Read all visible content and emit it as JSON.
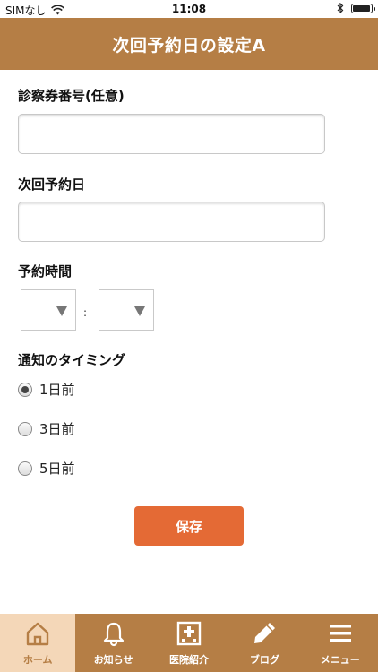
{
  "status_bar": {
    "carrier": "SIMなし",
    "time": "11:08",
    "battery_level": 0.95
  },
  "header": {
    "title": "次回予約日の設定A"
  },
  "form": {
    "card_number_label": "診察券番号(任意)",
    "card_number_value": "",
    "next_date_label": "次回予約日",
    "next_date_value": "",
    "time_label": "予約時間",
    "hour_value": "",
    "minute_value": "",
    "time_separator": ":",
    "timing_label": "通知のタイミング",
    "timing_options": [
      {
        "label": "1日前",
        "checked": true
      },
      {
        "label": "3日前",
        "checked": false
      },
      {
        "label": "5日前",
        "checked": false
      }
    ],
    "save_label": "保存"
  },
  "tabbar": {
    "items": [
      {
        "label": "ホーム",
        "icon": "home-icon",
        "active": true
      },
      {
        "label": "お知らせ",
        "icon": "bell-icon",
        "active": false
      },
      {
        "label": "医院紹介",
        "icon": "hospital-icon",
        "active": false
      },
      {
        "label": "ブログ",
        "icon": "pencil-icon",
        "active": false
      },
      {
        "label": "メニュー",
        "icon": "menu-icon",
        "active": false
      }
    ]
  },
  "colors": {
    "brand": "#b57e45",
    "accent": "#e46a35",
    "tab_active_bg": "#f4d7b8"
  }
}
